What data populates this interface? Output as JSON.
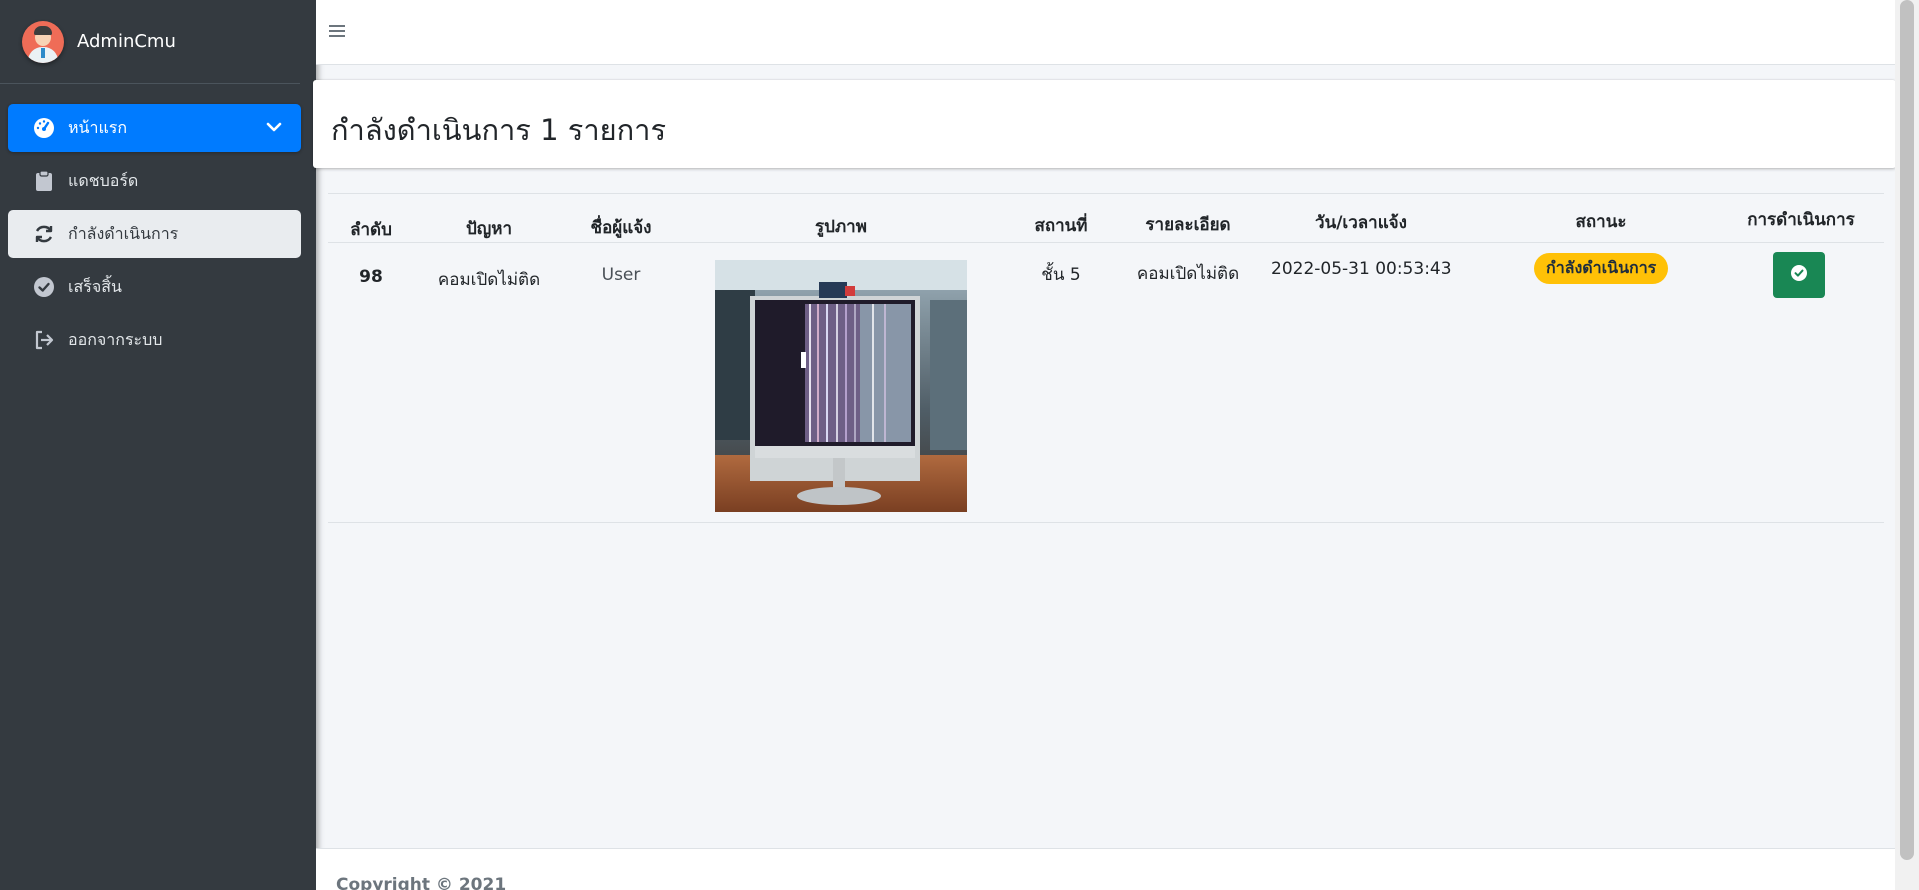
{
  "brand": {
    "name": "AdminCmu"
  },
  "sidebar": {
    "items": [
      {
        "label": "หน้าแรก",
        "icon": "dashboard-gauge-icon"
      },
      {
        "label": "แดชบอร์ด",
        "icon": "clipboard-icon"
      },
      {
        "label": "กำลังดำเนินการ",
        "icon": "sync-icon"
      },
      {
        "label": "เสร็จสิ้น",
        "icon": "check-circle-icon"
      },
      {
        "label": "ออกจากระบบ",
        "icon": "sign-out-icon"
      }
    ]
  },
  "header": {
    "title": "กำลังดำเนินการ 1 รายการ"
  },
  "table": {
    "columns": [
      "ลำดับ",
      "ปัญหา",
      "ชื่อผู้แจ้ง",
      "รูปภาพ",
      "สถานที่",
      "รายละเอียด",
      "วัน/เวลาแจ้ง",
      "สถานะ",
      "การดำเนินการ"
    ],
    "rows": [
      {
        "id": "98",
        "problem": "คอมเปิดไม่ติด",
        "reporter": "User",
        "location": "ชั้น 5",
        "detail": "คอมเปิดไม่ติด",
        "datetime": "2022-05-31 00:53:43",
        "status": "กำลังดำเนินการ",
        "status_color": "#ffc107",
        "action_icon": "check-circle-icon"
      }
    ]
  },
  "footer": {
    "text": "Copyright © 2021"
  },
  "colors": {
    "sidebar": "#343a40",
    "primary": "#007bff",
    "warning": "#ffc107",
    "success": "#198754"
  }
}
